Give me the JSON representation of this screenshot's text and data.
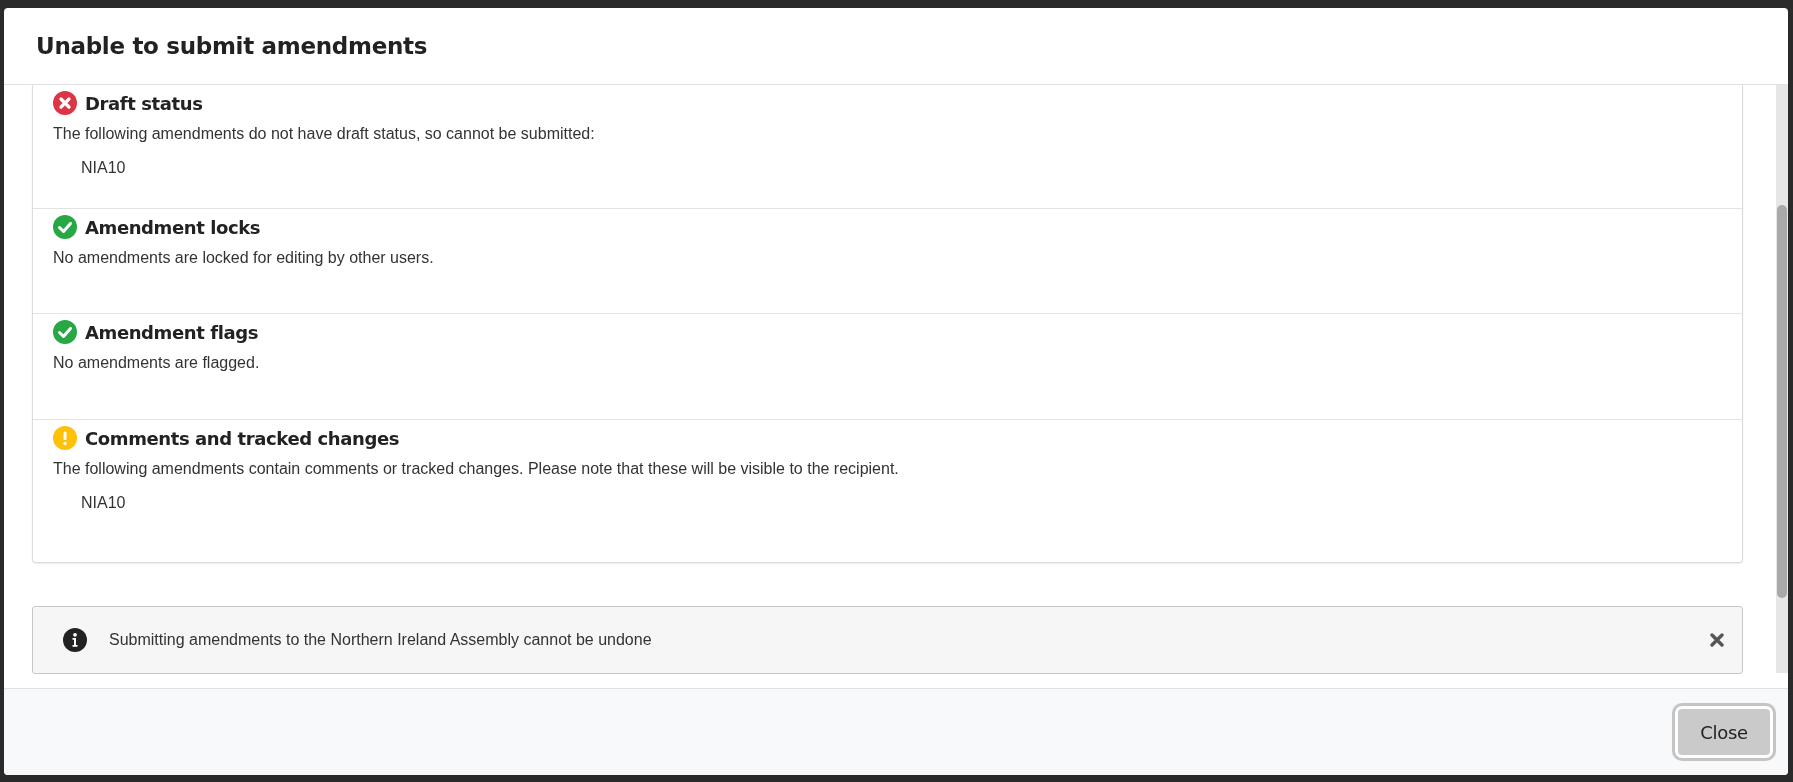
{
  "dialog": {
    "title": "Unable to submit amendments",
    "checks": [
      {
        "kind": "error",
        "title": "Draft status",
        "text": "The following amendments do not have draft status, so cannot be submitted:",
        "items": [
          "NIA10"
        ]
      },
      {
        "kind": "success",
        "title": "Amendment locks",
        "text": "No amendments are locked for editing by other users."
      },
      {
        "kind": "success",
        "title": "Amendment flags",
        "text": "No amendments are flagged."
      },
      {
        "kind": "warning",
        "title": "Comments and tracked changes",
        "text": "The following amendments contain comments or tracked changes. Please note that these will be visible to the recipient.",
        "items": [
          "NIA10"
        ]
      }
    ],
    "notice": {
      "text": "Submitting amendments to the Northern Ireland Assembly cannot be undone"
    },
    "buttons": [
      {
        "label": "Close"
      }
    ]
  }
}
